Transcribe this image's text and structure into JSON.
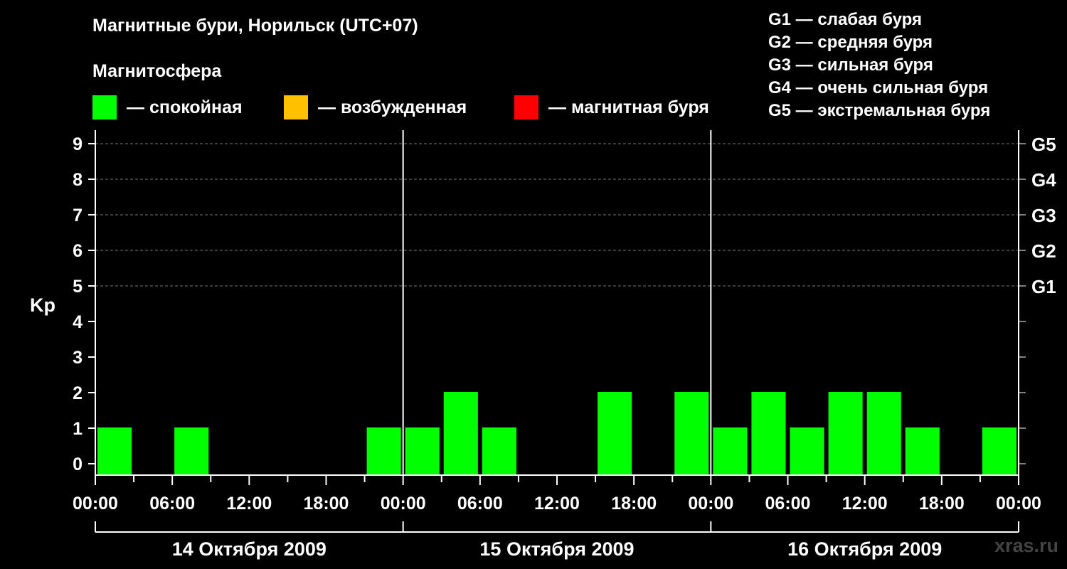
{
  "header": {
    "title": "Магнитные бури, Норильск (UTC+07)",
    "subtitle": "Магнитосфера"
  },
  "legend": [
    {
      "label": "— спокойная",
      "color": "#00ff00"
    },
    {
      "label": "— возбужденная",
      "color": "#ffc000"
    },
    {
      "label": "— магнитная буря",
      "color": "#ff0000"
    }
  ],
  "storm_scale": [
    "G1 — слабая буря",
    "G2 — средняя буря",
    "G3 — сильная буря",
    "G4 — очень сильная буря",
    "G5 — экстремальная буря"
  ],
  "watermark": "xras.ru",
  "chart_data": {
    "type": "bar",
    "ylabel": "Kp",
    "ylim": [
      0,
      9
    ],
    "yticks": [
      "0",
      "1",
      "2",
      "3",
      "4",
      "5",
      "6",
      "7",
      "8",
      "9"
    ],
    "right_ticks": [
      {
        "kp": 5,
        "label": "G1"
      },
      {
        "kp": 6,
        "label": "G2"
      },
      {
        "kp": 7,
        "label": "G3"
      },
      {
        "kp": 8,
        "label": "G4"
      },
      {
        "kp": 9,
        "label": "G5"
      }
    ],
    "xticks": [
      "00:00",
      "06:00",
      "12:00",
      "18:00",
      "00:00",
      "06:00",
      "12:00",
      "18:00",
      "00:00",
      "06:00",
      "12:00",
      "18:00",
      "00:00"
    ],
    "days": [
      "14 Октября 2009",
      "15 Октября 2009",
      "16 Октября 2009"
    ],
    "bar_color": "#00ff00",
    "series": [
      {
        "values": [
          1,
          0,
          1,
          0,
          0,
          0,
          0,
          1,
          1,
          2,
          1,
          0,
          0,
          2,
          0,
          2,
          1,
          2,
          1,
          2,
          2,
          1,
          0,
          1
        ]
      }
    ],
    "grid": true
  }
}
